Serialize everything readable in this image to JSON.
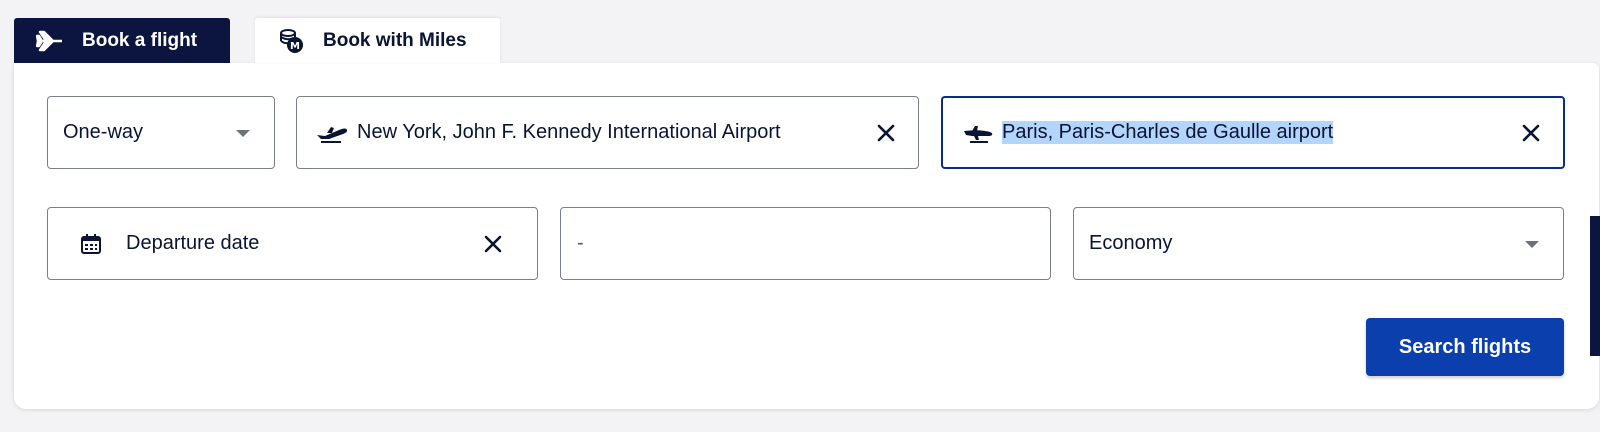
{
  "tabs": {
    "book_flight": {
      "label": "Book a flight",
      "icon": "airplane-icon"
    },
    "book_miles": {
      "label": "Book with Miles",
      "icon": "miles-coins-icon"
    }
  },
  "form": {
    "trip_type": {
      "value": "One-way"
    },
    "origin": {
      "value": "New York, John F. Kennedy International Airport",
      "icon": "takeoff-icon"
    },
    "destination": {
      "value": "Paris, Paris-Charles de Gaulle airport",
      "icon": "landing-icon",
      "selected": true
    },
    "departure_date": {
      "placeholder": "Departure date",
      "icon": "calendar-icon"
    },
    "return_date": {
      "value": "-"
    },
    "cabin_class": {
      "value": "Economy"
    },
    "search_button": {
      "label": "Search flights"
    }
  },
  "colors": {
    "navy": "#0b1540",
    "button_blue": "#0a3fad",
    "active_border": "#0b2a8f",
    "selection": "#b3d4fb"
  }
}
